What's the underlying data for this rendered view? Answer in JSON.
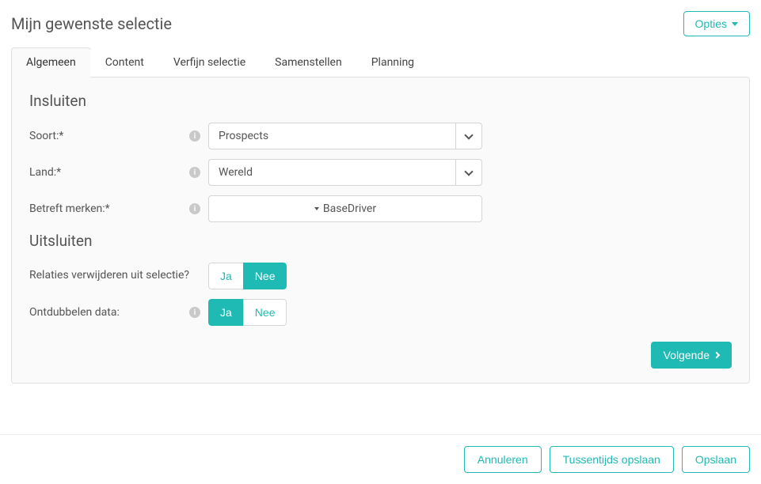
{
  "header": {
    "title": "Mijn gewenste selectie",
    "options_label": "Opties"
  },
  "tabs": [
    {
      "label": "Algemeen"
    },
    {
      "label": "Content"
    },
    {
      "label": "Verfijn selectie"
    },
    {
      "label": "Samenstellen"
    },
    {
      "label": "Planning"
    }
  ],
  "sections": {
    "include_title": "Insluiten",
    "exclude_title": "Uitsluiten"
  },
  "fields": {
    "soort": {
      "label": "Soort:*",
      "value": "Prospects"
    },
    "land": {
      "label": "Land:*",
      "value": "Wereld"
    },
    "merken": {
      "label": "Betreft merken:*",
      "value": "BaseDriver"
    },
    "relaties": {
      "label": "Relaties verwijderen uit selectie?",
      "ja": "Ja",
      "nee": "Nee",
      "selected": "Nee"
    },
    "ontdubbelen": {
      "label": "Ontdubbelen data:",
      "ja": "Ja",
      "nee": "Nee",
      "selected": "Ja"
    }
  },
  "buttons": {
    "next": "Volgende",
    "cancel": "Annuleren",
    "save_draft": "Tussentijds opslaan",
    "save": "Opslaan"
  }
}
